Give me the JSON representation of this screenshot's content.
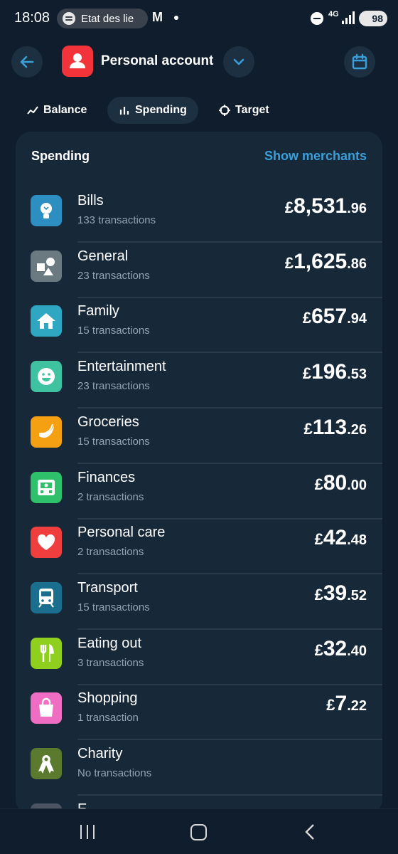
{
  "status_bar": {
    "time": "18:08",
    "media_label": "Etat des lie",
    "network": "4G",
    "battery": "98"
  },
  "header": {
    "account_title": "Personal account"
  },
  "tabs": [
    {
      "label": "Balance",
      "icon": "line-chart-icon",
      "active": false
    },
    {
      "label": "Spending",
      "icon": "bar-chart-icon",
      "active": true
    },
    {
      "label": "Target",
      "icon": "crosshair-icon",
      "active": false
    }
  ],
  "spending": {
    "title": "Spending",
    "show_merchants_label": "Show merchants",
    "categories": [
      {
        "name": "Bills",
        "count": "133 transactions",
        "currency": "£",
        "whole": "8,531",
        "decimal": ".96",
        "icon": "lightbulb-icon",
        "color": "#2d8fc1"
      },
      {
        "name": "General",
        "count": "23 transactions",
        "currency": "£",
        "whole": "1,625",
        "decimal": ".86",
        "icon": "shapes-icon",
        "color": "#6b7a80"
      },
      {
        "name": "Family",
        "count": "15 transactions",
        "currency": "£",
        "whole": "657",
        "decimal": ".94",
        "icon": "house-icon",
        "color": "#2fa6c2"
      },
      {
        "name": "Entertainment",
        "count": "23 transactions",
        "currency": "£",
        "whole": "196",
        "decimal": ".53",
        "icon": "smiley-icon",
        "color": "#3fc2a0"
      },
      {
        "name": "Groceries",
        "count": "15 transactions",
        "currency": "£",
        "whole": "113",
        "decimal": ".26",
        "icon": "banana-icon",
        "color": "#f5a012"
      },
      {
        "name": "Finances",
        "count": "2 transactions",
        "currency": "£",
        "whole": "80",
        "decimal": ".00",
        "icon": "money-icon",
        "color": "#2ec06a"
      },
      {
        "name": "Personal care",
        "count": "2 transactions",
        "currency": "£",
        "whole": "42",
        "decimal": ".48",
        "icon": "heart-icon",
        "color": "#f03e3e"
      },
      {
        "name": "Transport",
        "count": "15 transactions",
        "currency": "£",
        "whole": "39",
        "decimal": ".52",
        "icon": "train-icon",
        "color": "#1a6f8f"
      },
      {
        "name": "Eating out",
        "count": "3 transactions",
        "currency": "£",
        "whole": "32",
        "decimal": ".40",
        "icon": "cutlery-icon",
        "color": "#8fcf1e"
      },
      {
        "name": "Shopping",
        "count": "1 transaction",
        "currency": "£",
        "whole": "7",
        "decimal": ".22",
        "icon": "shopping-bag-icon",
        "color": "#ef6ec3"
      },
      {
        "name": "Charity",
        "count": "No transactions",
        "currency": "",
        "whole": "",
        "decimal": "",
        "icon": "ribbon-icon",
        "color": "#5c7a2e"
      },
      {
        "name": "E",
        "count": "",
        "currency": "",
        "whole": "",
        "decimal": "",
        "icon": "category-icon",
        "color": "#4a5561"
      }
    ]
  }
}
